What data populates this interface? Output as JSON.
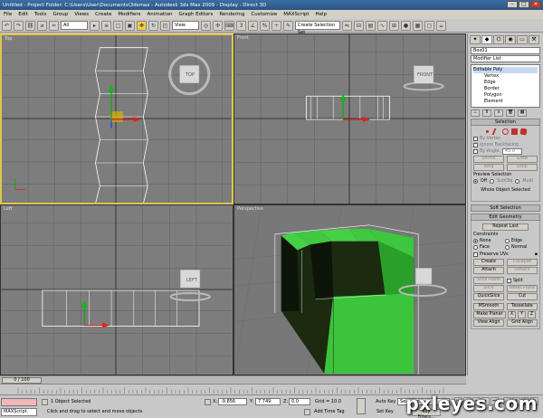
{
  "window": {
    "title": "Untitled    - Project Folder: C:\\Users\\User\\Documents\\3dsmax    - Autodesk 3ds Max  2009        - Display : Direct 3D"
  },
  "menu": [
    "File",
    "Edit",
    "Tools",
    "Group",
    "Views",
    "Create",
    "Modifiers",
    "Animation",
    "Graph Editors",
    "Rendering",
    "Customize",
    "MAXScript",
    "Help"
  ],
  "toolbar": {
    "filter_select": "All",
    "coord_select": "View",
    "named_selection": "Create Selection Set"
  },
  "viewports": {
    "top": "Top",
    "front": "Front",
    "left": "Left",
    "perspective": "Perspective",
    "cube_top": "TOP",
    "cube_front": "FRONT",
    "cube_left": "LEFT"
  },
  "command_panel": {
    "object_name": "Box01",
    "modifier_list": "Modifier List",
    "stack": {
      "top": "Editable Poly",
      "items": [
        "Vertex",
        "Edge",
        "Border",
        "Polygon",
        "Element"
      ]
    },
    "selection": {
      "title": "Selection",
      "by_vertex": "By Vertex",
      "ignore_backfacing": "Ignore Backfacing",
      "by_angle": "By Angle:",
      "angle_value": "45.0",
      "shrink": "Shrink",
      "grow": "Grow",
      "ring": "Ring",
      "loop": "Loop",
      "preview_title": "Preview Selection",
      "preview_off": "Off",
      "preview_subobj": "SubObj",
      "preview_multi": "Multi",
      "status": "Whole Object Selected"
    },
    "soft_selection": "Soft Selection",
    "edit_geometry": {
      "title": "Edit Geometry",
      "repeat_last": "Repeat Last",
      "constraints": "Constraints",
      "none": "None",
      "edge": "Edge",
      "face": "Face",
      "normal": "Normal",
      "preserve_uvs": "Preserve UVs",
      "create": "Create",
      "collapse": "Collapse",
      "attach": "Attach",
      "detach": "Detach",
      "slice_plane": "Slice Plane",
      "split": "Split",
      "slice": "Slice",
      "reset_plane": "Reset Plane",
      "quickslice": "QuickSlice",
      "cut": "Cut",
      "msmooth": "MSmooth",
      "tessellate": "Tessellate",
      "make_planar": "Make Planar",
      "x": "X",
      "y": "Y",
      "z": "Z",
      "view_align": "View Align",
      "grid_align": "Grid Align"
    }
  },
  "time": {
    "frame": "0 / 100"
  },
  "status": {
    "maxscript": "MAXScript.",
    "selected": "1 Object Selected",
    "prompt": "Click and drag to select and move objects",
    "x": "-9.856",
    "y": "7.749",
    "z": "0.0",
    "grid": "Grid = 10.0",
    "add_time_tag": "Add Time Tag",
    "auto_key": "Auto Key",
    "auto_key_value": "Selected",
    "set_key": "Set Key",
    "key_filters": "Key Filters..."
  },
  "watermark": "pxleyes.com"
}
